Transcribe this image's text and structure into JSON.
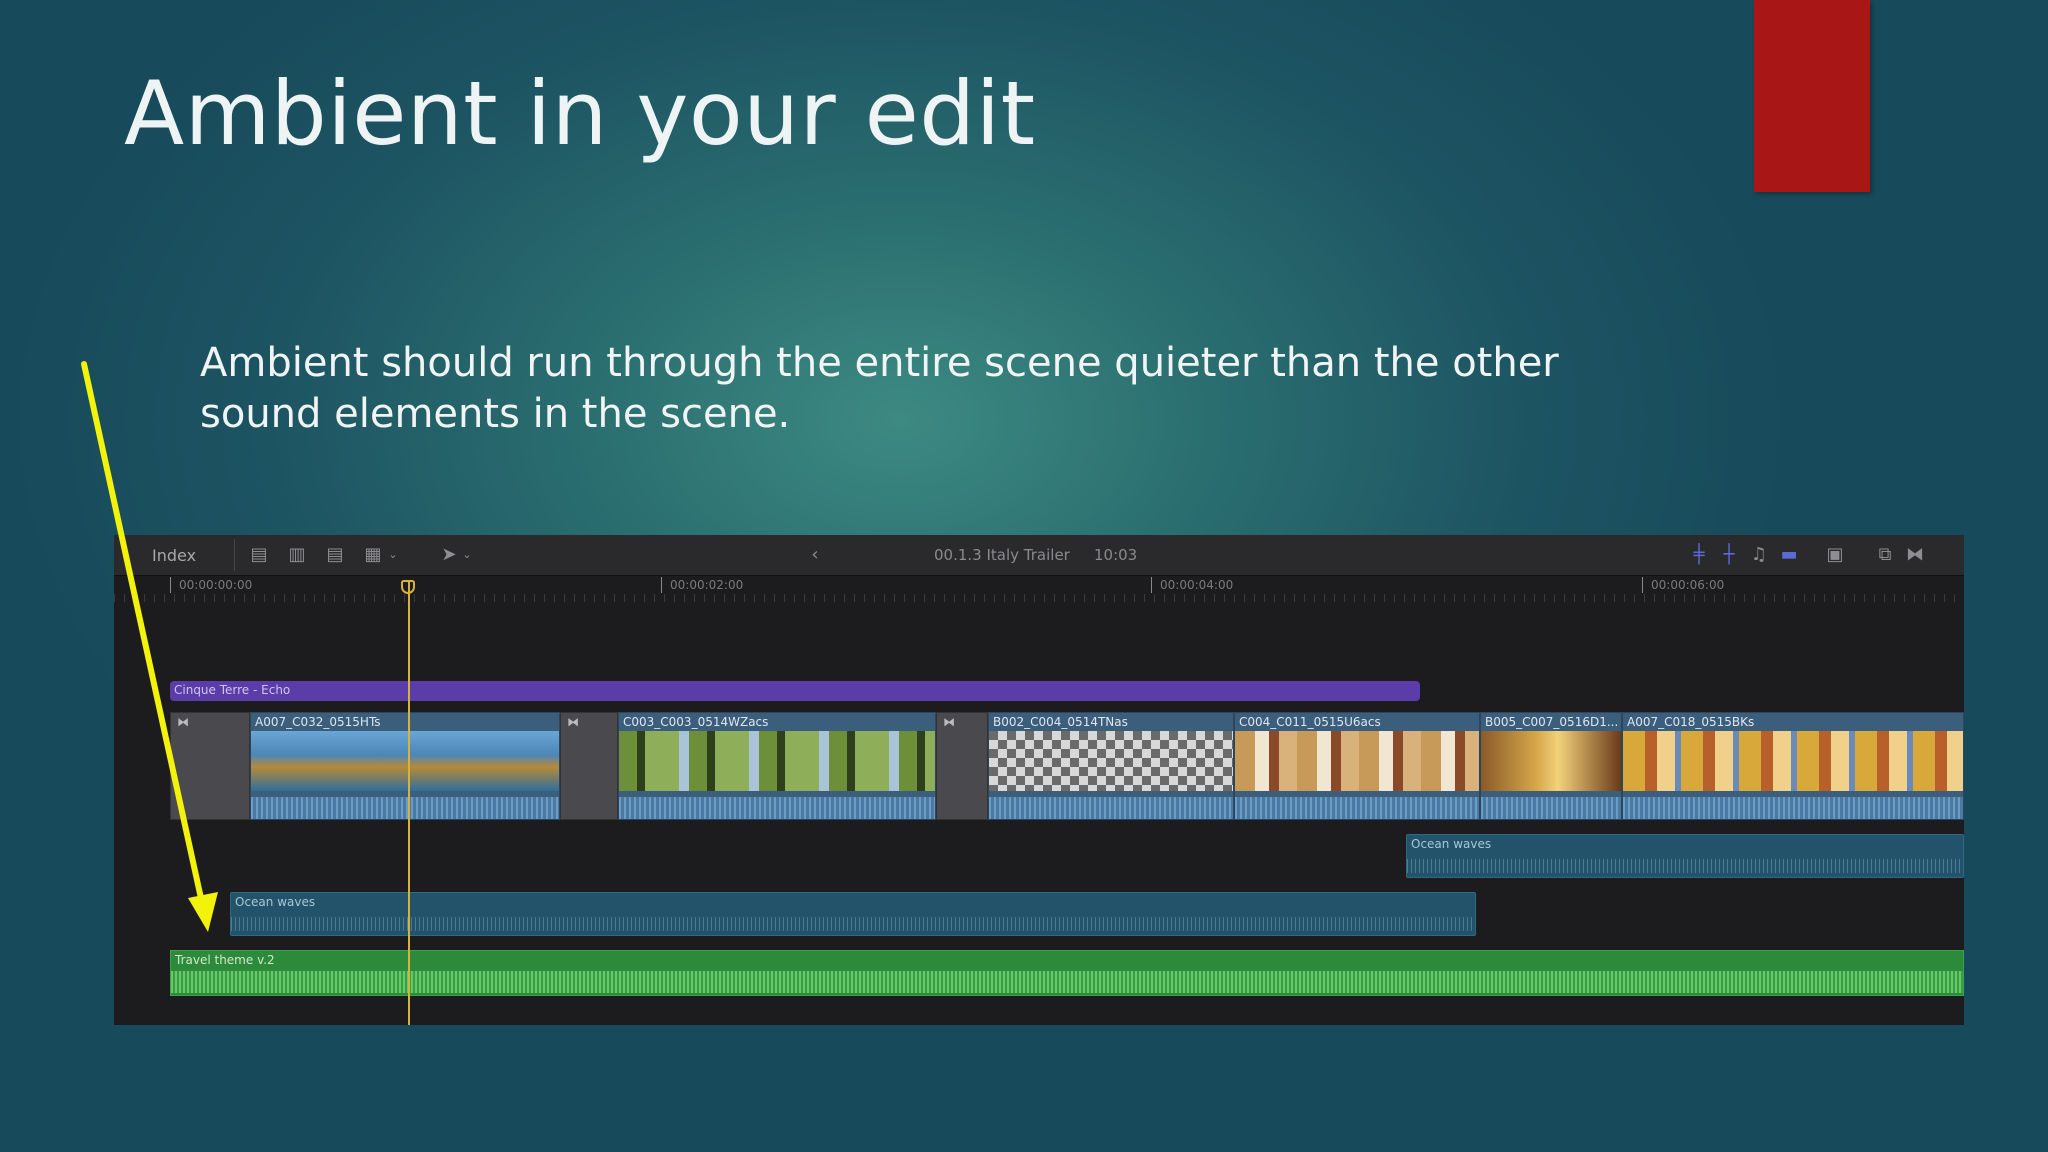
{
  "slide": {
    "title": "Ambient in your edit",
    "body": "Ambient should run through the entire scene quieter than the other sound elements in the scene.",
    "accent_color": "#a81616",
    "arrow_color": "#f2f20a"
  },
  "editor": {
    "index_label": "Index",
    "project_name": "00.1.3  Italy Trailer",
    "duration": "10:03",
    "ruler_ticks": [
      "00:00:00:00",
      "00:00:02:00",
      "00:00:04:00",
      "00:00:06:00"
    ],
    "title_clip": "Cinque Terre - Echo",
    "video_clips": [
      "A007_C032_0515HTs",
      "C003_C003_0514WZacs",
      "B002_C004_0514TNas",
      "C004_C011_0515U6acs",
      "B005_C007_0516D1...",
      "A007_C018_0515BKs"
    ],
    "ambient_clips": [
      "Ocean waves",
      "Ocean waves"
    ],
    "music_clip": "Travel theme v.2"
  }
}
